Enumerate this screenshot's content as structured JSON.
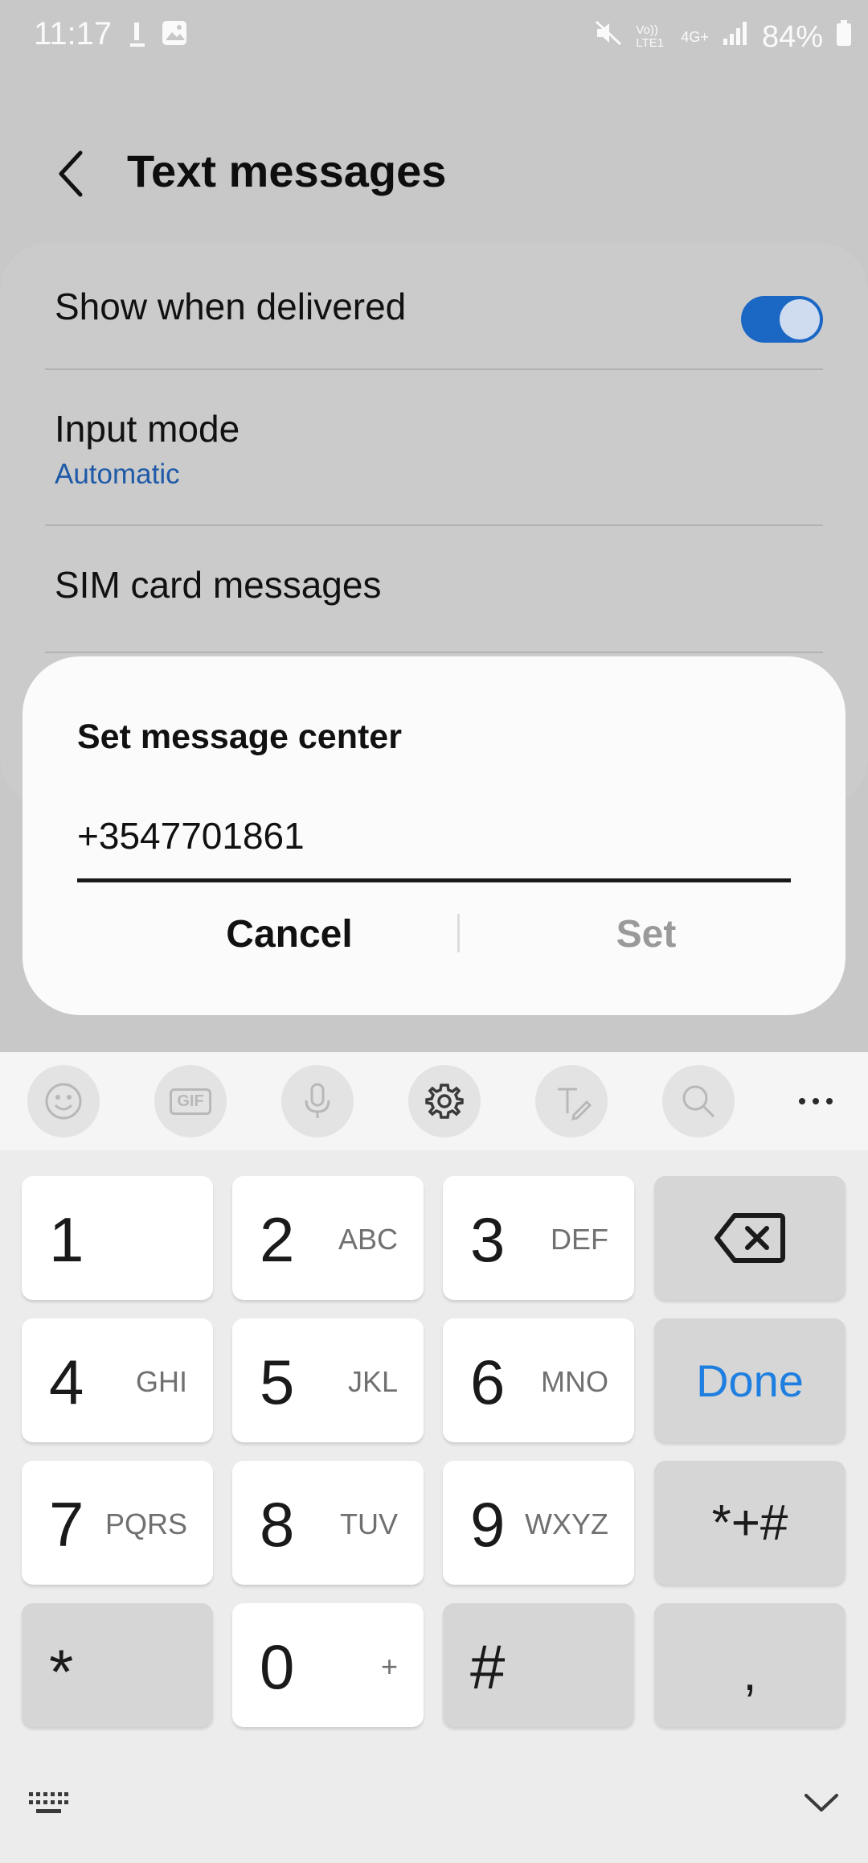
{
  "status_bar": {
    "time": "11:17",
    "battery": "84%",
    "network": "4G+",
    "volte": "Vo)) LTE1"
  },
  "app_bar": {
    "title": "Text messages",
    "back_icon": "back-arrow-icon"
  },
  "settings": {
    "show_delivered": {
      "label": "Show when delivered",
      "enabled": true
    },
    "input_mode": {
      "label": "Input mode",
      "value": "Automatic"
    },
    "sim_messages": {
      "label": "SIM card messages"
    }
  },
  "dialog": {
    "title": "Set message center",
    "input_value": "+3547701861",
    "cancel_label": "Cancel",
    "set_label": "Set"
  },
  "keyboard": {
    "toolbar": [
      "emoji-icon",
      "gif-icon",
      "microphone-icon",
      "settings-icon",
      "handwriting-icon",
      "search-icon",
      "more-icon"
    ],
    "gif_label": "GIF",
    "keys": [
      {
        "num": "1",
        "letters": ""
      },
      {
        "num": "2",
        "letters": "ABC"
      },
      {
        "num": "3",
        "letters": "DEF"
      },
      {
        "num": "4",
        "letters": "GHI"
      },
      {
        "num": "5",
        "letters": "JKL"
      },
      {
        "num": "6",
        "letters": "MNO"
      },
      {
        "num": "7",
        "letters": "PQRS"
      },
      {
        "num": "8",
        "letters": "TUV"
      },
      {
        "num": "9",
        "letters": "WXYZ"
      },
      {
        "num": "*",
        "letters": ""
      },
      {
        "num": "0",
        "letters": "+"
      },
      {
        "num": "#",
        "letters": ""
      }
    ],
    "done_label": "Done",
    "symbols_label": "*+#",
    "comma_label": ",",
    "accent_color": "#1f7fe0"
  }
}
